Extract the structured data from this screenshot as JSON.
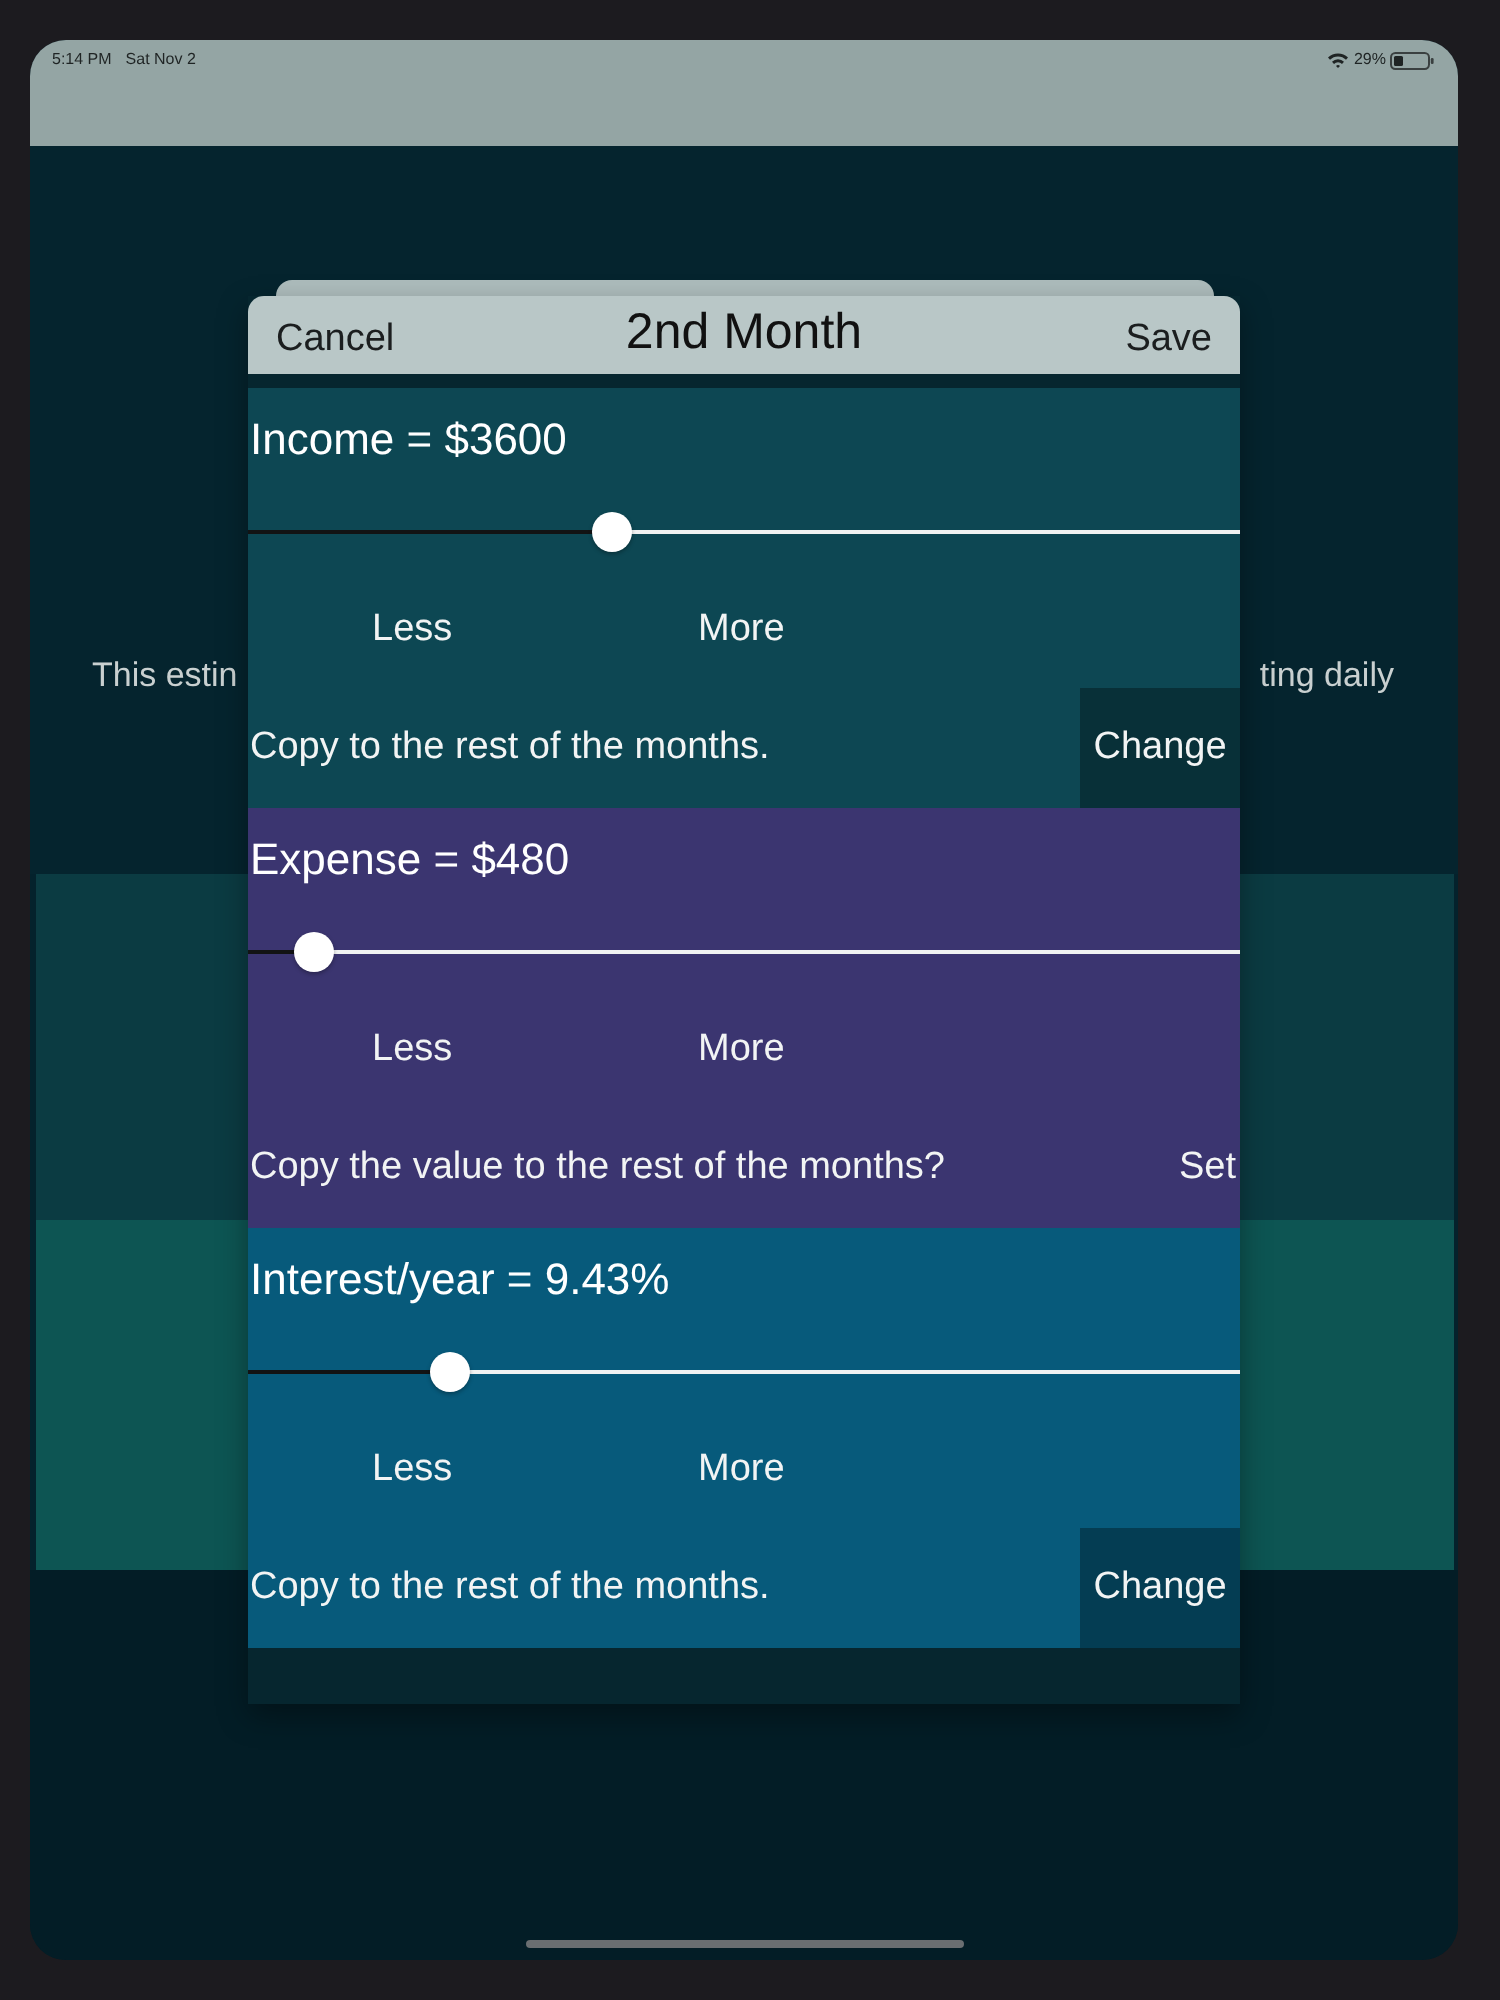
{
  "status_bar": {
    "time": "5:14 PM",
    "date": "Sat Nov 2",
    "battery": "29%"
  },
  "background": {
    "text_left": "This estin",
    "text_right": "ting daily"
  },
  "modal": {
    "cancel": "Cancel",
    "title": "2nd Month",
    "save": "Save",
    "sections": [
      {
        "title": "Income = $3600",
        "color": "#0d4753",
        "level": 0.367,
        "less": "Less",
        "more": "More",
        "copy_text": "Copy to the rest of the months.",
        "action": {
          "label": "Change",
          "kind": "filled"
        }
      },
      {
        "title": "Expense = $480",
        "color": "#3b3570",
        "level": 0.067,
        "less": "Less",
        "more": "More",
        "copy_text": "Copy the value to the rest of the months?",
        "action": {
          "label": "Set",
          "kind": "plain"
        }
      },
      {
        "title": "Interest/year = 9.43%",
        "color": "#075a7b",
        "level": 0.204,
        "less": "Less",
        "more": "More",
        "copy_text": "Copy to the rest of the months.",
        "action": {
          "label": "Change",
          "kind": "filled"
        }
      }
    ]
  }
}
